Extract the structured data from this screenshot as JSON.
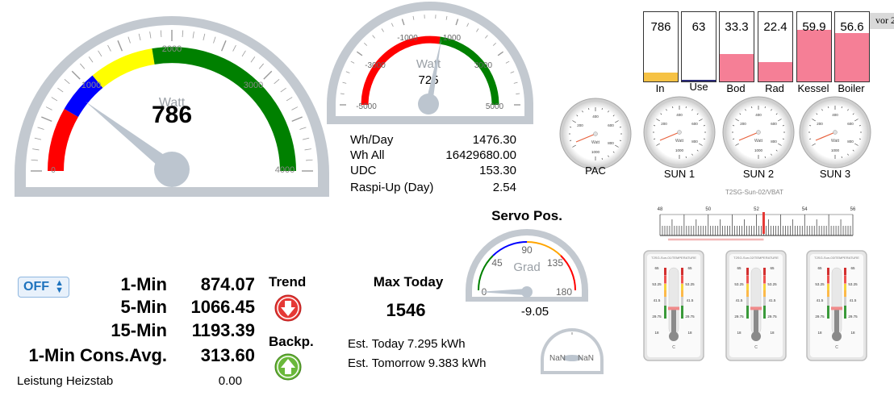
{
  "main_gauge": {
    "unit": "Watt",
    "value": "786",
    "ticks": [
      "0",
      "1000",
      "2000",
      "3000",
      "4000"
    ]
  },
  "grid_gauge": {
    "unit": "Watt",
    "value": "725",
    "ticks": [
      "-5000",
      "-3000",
      "-1000",
      "1000",
      "3000",
      "5000"
    ]
  },
  "stats": [
    {
      "label": "Wh/Day",
      "value": "1476.30"
    },
    {
      "label": "Wh All",
      "value": "16429680.00"
    },
    {
      "label": "UDC",
      "value": "153.30"
    },
    {
      "label": "Raspi-Up (Day)",
      "value": "2.54"
    }
  ],
  "bars": [
    {
      "label": "In",
      "value": "786",
      "level": 0.13,
      "color": "#f6c244"
    },
    {
      "label": "Use",
      "value": "63",
      "level": 0.02,
      "color": "#2b2b7a"
    },
    {
      "label": "Bod",
      "value": "33.3",
      "level": 0.4,
      "color": "#f57f96"
    },
    {
      "label": "Rad",
      "value": "22.4",
      "level": 0.28,
      "color": "#f57f96"
    },
    {
      "label": "Kessel",
      "value": "59.9",
      "level": 0.74,
      "color": "#f57f96"
    },
    {
      "label": "Boiler",
      "value": "56.6",
      "level": 0.7,
      "color": "#f57f96"
    }
  ],
  "vor_tab": "vor 2",
  "mini_gauges": [
    {
      "label": "PAC",
      "ticks": [
        "200",
        "400",
        "600",
        "800",
        "1000"
      ],
      "unit": "Watt"
    },
    {
      "label": "SUN 1",
      "ticks": [
        "200",
        "400",
        "600",
        "800",
        "1000"
      ],
      "unit": "Watt"
    },
    {
      "label": "SUN 2",
      "ticks": [
        "200",
        "400",
        "600",
        "800",
        "1000"
      ],
      "unit": "Watt"
    },
    {
      "label": "SUN 3",
      "ticks": [
        "200",
        "400",
        "600",
        "800",
        "1000"
      ],
      "unit": "Watt"
    }
  ],
  "vbat": {
    "caption": "T2SG-Sun-02/VBAT",
    "ticks": [
      "48",
      "50",
      "52",
      "54",
      "56"
    ],
    "level": 52.3
  },
  "servo": {
    "title": "Servo Pos.",
    "unit": "Grad",
    "value": "-9.05",
    "ticks": [
      "0",
      "45",
      "90",
      "135",
      "180"
    ]
  },
  "nan_gauge": {
    "left": "NaN",
    "right": "NaN"
  },
  "thermometers": [
    {
      "caption": "T2SG-Sun-01/TEMPERATURE",
      "ticks": [
        "65",
        "53.25",
        "41.5",
        "29.75",
        "18"
      ],
      "unit": "C",
      "level": 0.37
    },
    {
      "caption": "T2SG-Sun-02/TEMPERATURE",
      "ticks": [
        "65",
        "53.25",
        "41.5",
        "29.75",
        "18"
      ],
      "unit": "C",
      "level": 0.37
    },
    {
      "caption": "T2SG-Sun-03/TEMPERATURE",
      "ticks": [
        "65",
        "53.25",
        "41.5",
        "29.75",
        "18"
      ],
      "unit": "C",
      "level": 0.37
    }
  ],
  "controls": {
    "toggle": "OFF"
  },
  "averages": [
    {
      "label": "1-Min",
      "value": "874.07"
    },
    {
      "label": "5-Min",
      "value": "1066.45"
    },
    {
      "label": "15-Min",
      "value": "1193.39"
    },
    {
      "label": "1-Min Cons.Avg.",
      "value": "313.60"
    }
  ],
  "heizstab": {
    "label": "Leistung Heizstab",
    "value": "0.00"
  },
  "trend": {
    "label": "Trend"
  },
  "backp": {
    "label": "Backp."
  },
  "max_today": {
    "label": "Max Today",
    "value": "1546"
  },
  "estimates": {
    "today": "Est. Today 7.295 kWh",
    "tomorrow": "Est. Tomorrow 9.383 kWh"
  }
}
